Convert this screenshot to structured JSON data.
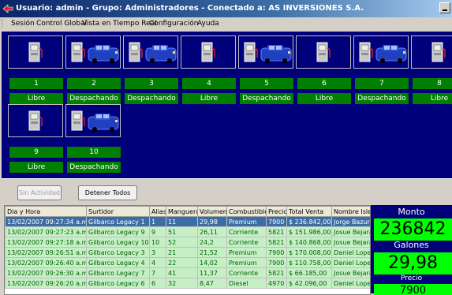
{
  "window": {
    "title": "Usuario: admin - Grupo: Administradores - Conectado a: AS INVERSIONES S.A."
  },
  "menu": [
    "Sesión",
    "Control Global",
    "Vista en Tiempo Real",
    "Configuración",
    "Ayuda"
  ],
  "pumps": [
    {
      "number": "1",
      "status": "Libre",
      "has_car": false
    },
    {
      "number": "2",
      "status": "Despachando",
      "has_car": true
    },
    {
      "number": "3",
      "status": "Despachando",
      "has_car": true
    },
    {
      "number": "4",
      "status": "Libre",
      "has_car": false
    },
    {
      "number": "5",
      "status": "Despachando",
      "has_car": true
    },
    {
      "number": "6",
      "status": "Libre",
      "has_car": false
    },
    {
      "number": "7",
      "status": "Despachando",
      "has_car": true
    },
    {
      "number": "8",
      "status": "Libre",
      "has_car": false
    },
    {
      "number": "9",
      "status": "Libre",
      "has_car": false
    },
    {
      "number": "10",
      "status": "Despachando",
      "has_car": true
    }
  ],
  "controls": {
    "idle_button": "Sin Actividad",
    "stop_all_button": "Detener Todos"
  },
  "table": {
    "columns": [
      "Dia y Hora",
      "Surtidor",
      "Alias",
      "Manguera",
      "Volumen",
      "Combustible",
      "Precio",
      "Total Venta",
      "Nombre Islero"
    ],
    "rows": [
      [
        "13/02/2007 09:27:34 a.m.",
        "Gilbarco Legacy 1",
        "1",
        "11",
        "29,98",
        "Premium",
        "7900",
        "$ 236.842,00",
        "Jorge Bazurto"
      ],
      [
        "13/02/2007 09:27:23 a.m.",
        "Gilbarco Legacy 9",
        "9",
        "51",
        "26,11",
        "Corriente",
        "5821",
        "$ 151.986,00",
        "Josue Bejarano"
      ],
      [
        "13/02/2007 09:27:18 a.m.",
        "Gilbarco Legacy 10",
        "10",
        "52",
        "24,2",
        "Corriente",
        "5821",
        "$ 140.868,00",
        "Josue Bejarano"
      ],
      [
        "13/02/2007 09:26:51 a.m.",
        "Gilbarco Legacy 3",
        "3",
        "21",
        "21,52",
        "Premium",
        "7900",
        "$ 170.008,00",
        "Daniel Lopez"
      ],
      [
        "13/02/2007 09:26:40 a.m.",
        "Gilbarco Legacy 4",
        "4",
        "22",
        "14,02",
        "Premium",
        "7900",
        "$ 110.758,00",
        "Daniel Lopez"
      ],
      [
        "13/02/2007 09:26:30 a.m.",
        "Gilbarco Legacy 7",
        "7",
        "41",
        "11,37",
        "Corriente",
        "5821",
        "$ 66.185,00",
        "Josue Bejarano"
      ],
      [
        "13/02/2007 09:26:20 a.m.",
        "Gilbarco Legacy 6",
        "6",
        "32",
        "8,47",
        "Diesel",
        "4970",
        "$ 42.096,00",
        "Daniel Lopez"
      ]
    ]
  },
  "summary": {
    "amount_label": "Monto",
    "amount_value": "236842",
    "gallons_label": "Galones",
    "gallons_value": "29,98",
    "price_label": "Precio",
    "price_value": "7900"
  },
  "colors": {
    "panel": "#00007b",
    "status_green": "#007f00",
    "display_green": "#00ff00",
    "row_green": "#c6efc6",
    "selected_row": "#3a6ea5"
  }
}
